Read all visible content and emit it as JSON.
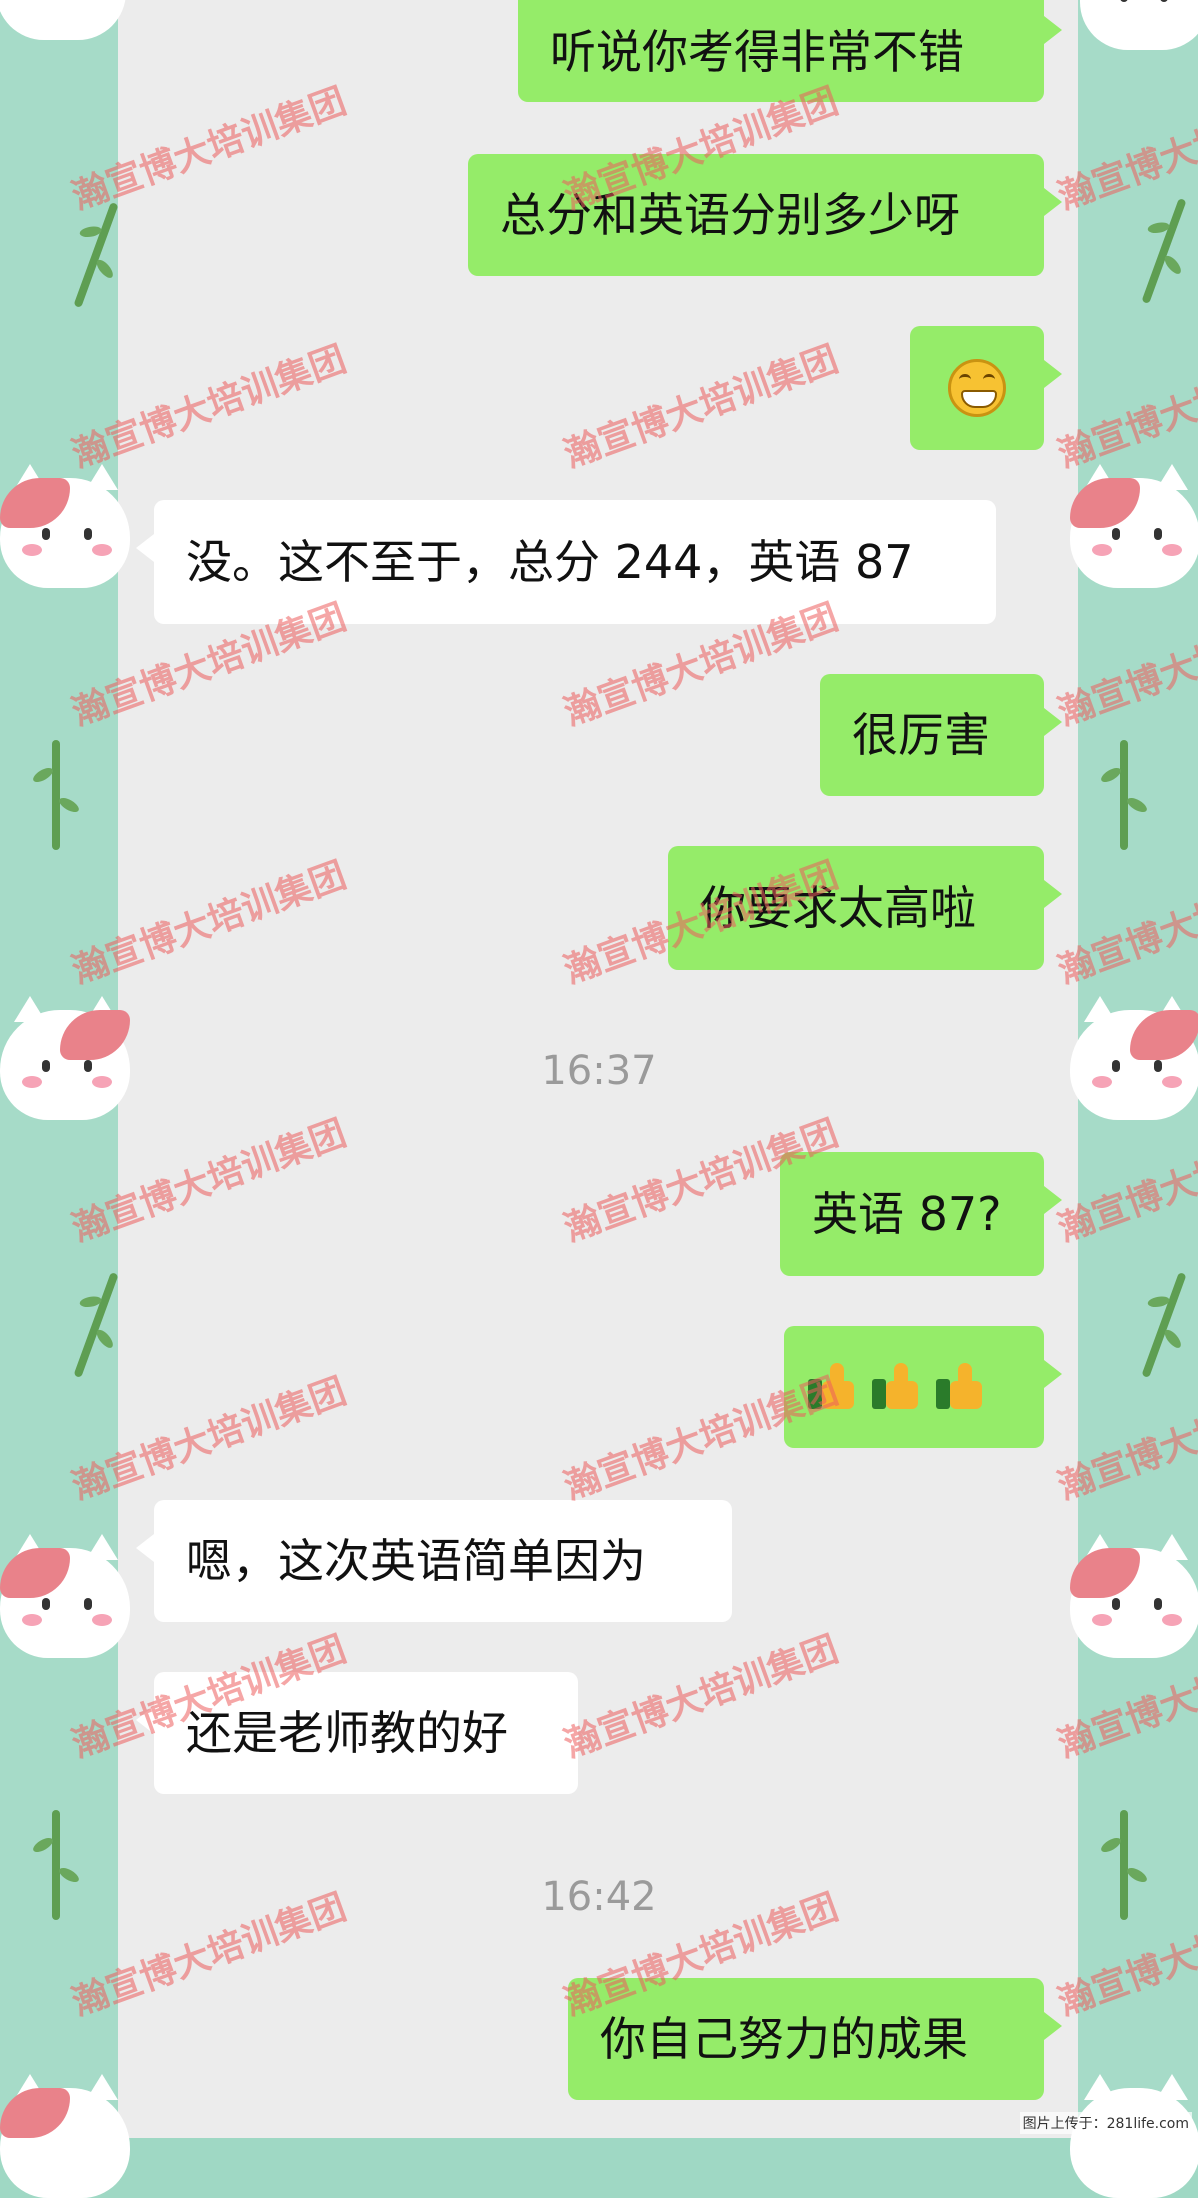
{
  "messages": {
    "m1": "听说你考得非常不错",
    "m2": "总分和英语分别多少呀",
    "m4": "没。这不至于，总分 244，英语 87",
    "m5": "很厉害",
    "m6": "你要求太高啦",
    "m7": "英语 87?",
    "m9": "嗯，这次英语简单因为",
    "m10": "还是老师教的好",
    "m11": "你自己努力的成果"
  },
  "timestamps": {
    "t1": "16:37",
    "t2": "16:42"
  },
  "watermark": "瀚宣博大培训集团",
  "footer": "图片上传于：281life.com",
  "colors": {
    "outgoing_bubble": "#95ec69",
    "incoming_bubble": "#ffffff",
    "chat_background": "#ececec",
    "wallpaper": "#a6dbc8"
  },
  "icons": [
    "grinning-emoji-icon",
    "thumbs-up-icon",
    "thumbs-up-icon",
    "thumbs-up-icon"
  ]
}
